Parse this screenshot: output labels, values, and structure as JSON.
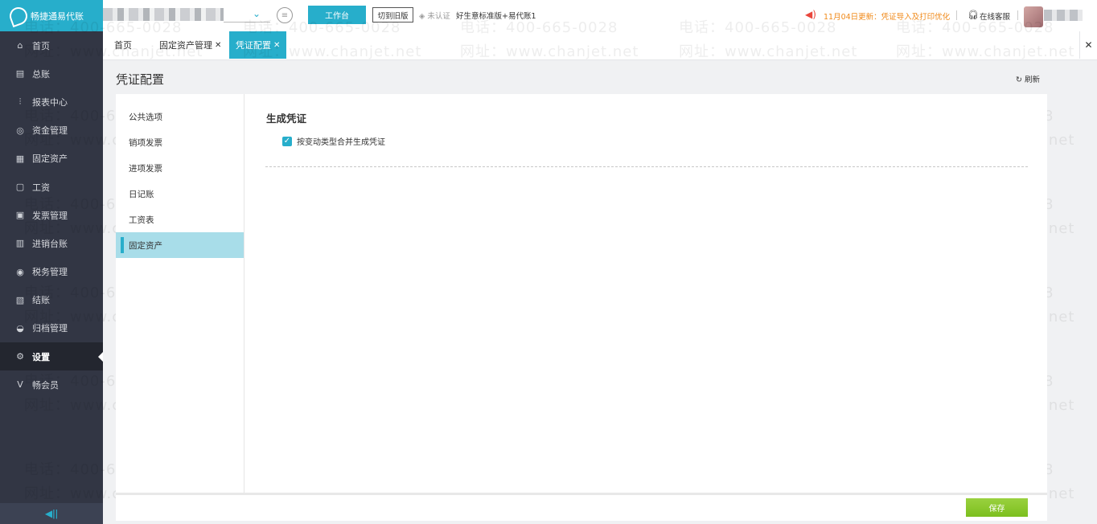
{
  "app": {
    "logo_text": "畅捷通易代账"
  },
  "sidebar": {
    "items": [
      {
        "label": "首页",
        "icon": "home-icon",
        "glyph": "⌂"
      },
      {
        "label": "总账",
        "icon": "ledger-icon",
        "glyph": "▤"
      },
      {
        "label": "报表中心",
        "icon": "chart-icon",
        "glyph": "⫶"
      },
      {
        "label": "资金管理",
        "icon": "money-icon",
        "glyph": "◎"
      },
      {
        "label": "固定资产",
        "icon": "building-icon",
        "glyph": "▦"
      },
      {
        "label": "工资",
        "icon": "salary-icon",
        "glyph": "▢"
      },
      {
        "label": "发票管理",
        "icon": "invoice-icon",
        "glyph": "▣"
      },
      {
        "label": "进销台账",
        "icon": "stock-icon",
        "glyph": "▥"
      },
      {
        "label": "税务管理",
        "icon": "tax-icon",
        "glyph": "◉"
      },
      {
        "label": "结账",
        "icon": "close-book-icon",
        "glyph": "▧"
      },
      {
        "label": "归档管理",
        "icon": "archive-icon",
        "glyph": "◒"
      },
      {
        "label": "设置",
        "icon": "gear-icon",
        "glyph": "⚙"
      },
      {
        "label": "畅会员",
        "icon": "vip-icon",
        "glyph": "V"
      }
    ],
    "active_index": 11,
    "collapse_glyph": "◀ǀǀ"
  },
  "topbar": {
    "workbench_label": "工作台",
    "switch_old_label": "切到旧版",
    "unverified_label": "未认证",
    "edition_label": "好生意标准版+易代账1",
    "notice_text": "11月04日更新：凭证导入及打印优化",
    "service_label": "在线客服"
  },
  "tabs": [
    {
      "label": "首页",
      "closable": false
    },
    {
      "label": "固定资产管理",
      "closable": true
    },
    {
      "label": "凭证配置",
      "closable": true,
      "active": true
    }
  ],
  "page": {
    "title": "凭证配置",
    "refresh_label": "刷新",
    "menu": [
      "公共选项",
      "销项发票",
      "进项发票",
      "日记账",
      "工资表",
      "固定资产"
    ],
    "menu_active_index": 5,
    "section_title": "生成凭证",
    "option_label": "按变动类型合并生成凭证",
    "option_checked": true,
    "save_label": "保存"
  },
  "watermark": {
    "phone": "电话：400-665-0028",
    "site": "网址：www.chanjet.net"
  },
  "colors": {
    "accent": "#27aecb",
    "sidebar_bg": "#323644",
    "save_green": "#8bc34a",
    "notice_orange": "#f08a1a"
  }
}
